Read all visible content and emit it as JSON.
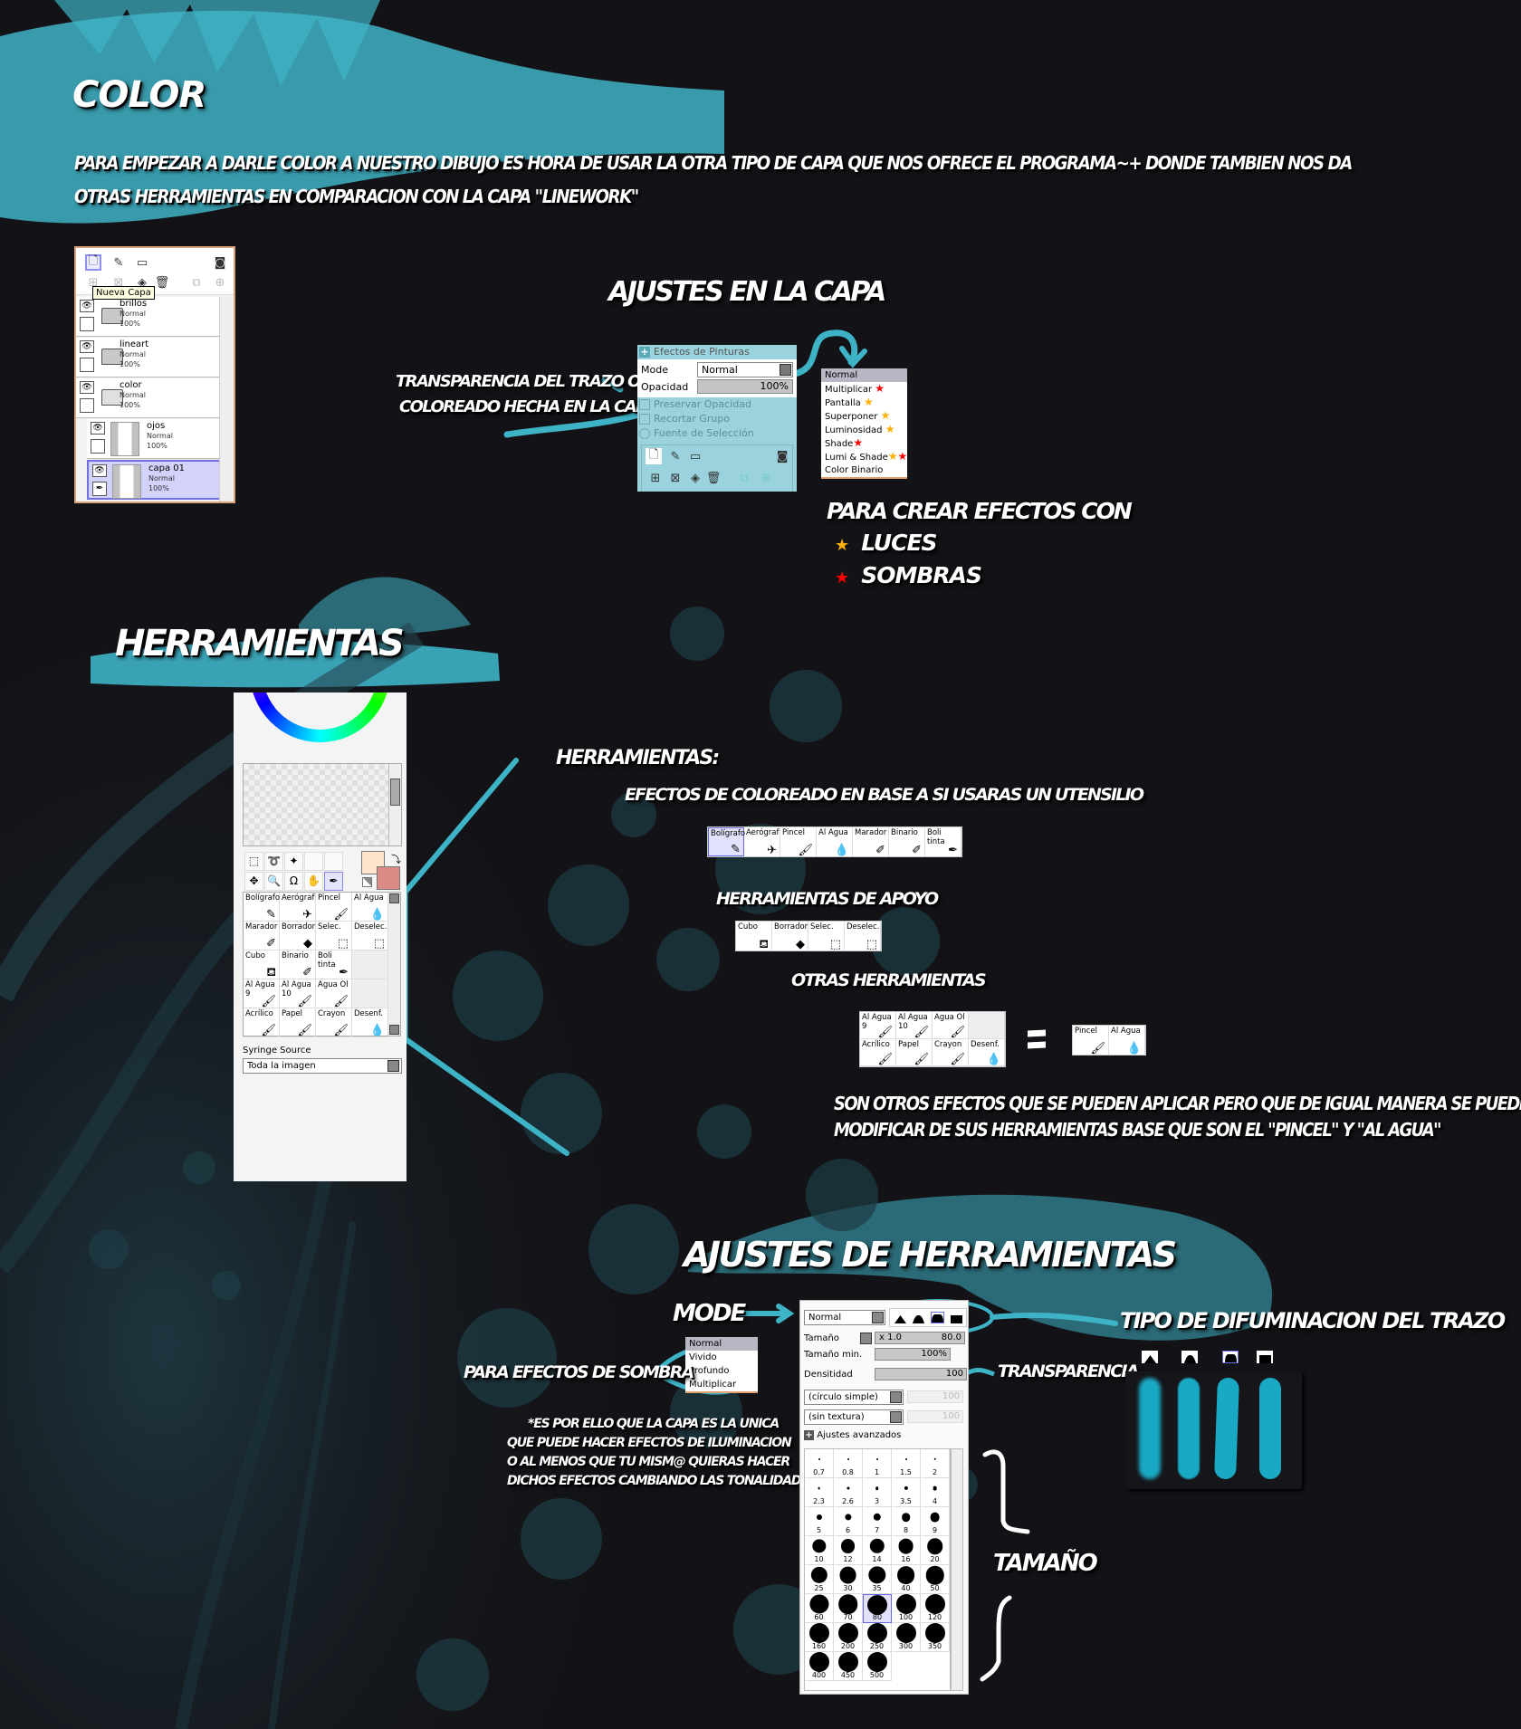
{
  "colors": {
    "background": "#131317",
    "accent": "#3fb3c6",
    "light_star": "#ffb000",
    "shadow_star": "#ff0000"
  },
  "color_section": {
    "title": "Color",
    "intro_line1": "Para empezar a darle color a nuestro dibujo es hora de usar la otra tipo de capa que nos ofrece el programa~+ donde tambien nos da",
    "intro_line2": "otras herramientas en comparacion con la capa \"linework\""
  },
  "layers_panel": {
    "tooltip": "Nueva Capa",
    "layers": [
      {
        "name": "brillos",
        "mode": "Normal",
        "opacity": "100%",
        "type": "folder"
      },
      {
        "name": "lineart",
        "mode": "Normal",
        "opacity": "100%",
        "type": "folder"
      },
      {
        "name": "color",
        "mode": "Normal",
        "opacity": "100%",
        "type": "folder-open"
      },
      {
        "name": "ojos",
        "mode": "Normal",
        "opacity": "100%",
        "type": "layer"
      },
      {
        "name": "capa 01",
        "mode": "Normal",
        "opacity": "100%",
        "type": "layer",
        "selected": true
      }
    ]
  },
  "layer_settings": {
    "title": "Ajustes en la capa",
    "panel_title": "Efectos de Pinturas",
    "mode_label": "Mode",
    "mode_value": "Normal",
    "opacity_label": "Opacidad",
    "opacity_value": "100%",
    "options": [
      "Preservar Opacidad",
      "Recortar Grupo",
      "Fuente de Selección"
    ],
    "annotation_opacity_line1": "Transparencia  del trazo o",
    "annotation_opacity_line2": "coloreado hecha en la capa",
    "mode_options": [
      {
        "label": "Normal",
        "stars": []
      },
      {
        "label": "Multiplicar",
        "stars": [
          "shadow"
        ]
      },
      {
        "label": "Pantalla",
        "stars": [
          "light"
        ]
      },
      {
        "label": "Superponer",
        "stars": [
          "light"
        ]
      },
      {
        "label": "Luminosidad",
        "stars": [
          "light"
        ]
      },
      {
        "label": "Shade",
        "stars": [
          "shadow"
        ]
      },
      {
        "label": "Lumi & Shade",
        "stars": [
          "light",
          "shadow"
        ]
      },
      {
        "label": "Color Binario",
        "stars": []
      }
    ],
    "effects_title": "Para crear efectos con",
    "legend_light": "Luces",
    "legend_shadow": "Sombras",
    "star_glyph": "★"
  },
  "tools_section": {
    "title": "Herramientas",
    "panel": {
      "tool_grid": [
        {
          "label": "Bolígrafo",
          "icon": "pencil-icon"
        },
        {
          "label": "Aerógraf",
          "icon": "airbrush-icon"
        },
        {
          "label": "Pincel",
          "icon": "brush-icon"
        },
        {
          "label": "Al Agua",
          "icon": "water-brush-icon"
        },
        {
          "label": "Marador",
          "icon": "marker-icon"
        },
        {
          "label": "Borrador",
          "icon": "eraser-icon"
        },
        {
          "label": "Selec.",
          "icon": "select-pen-icon"
        },
        {
          "label": "Deselec.",
          "icon": "deselect-eraser-icon"
        },
        {
          "label": "Cubo",
          "icon": "bucket-icon"
        },
        {
          "label": "Binario",
          "icon": "binary-pen-icon"
        },
        {
          "label": "Boli tinta",
          "icon": "ink-pen-icon"
        },
        {
          "label": "",
          "icon": ""
        },
        {
          "label": "Al Agua 9",
          "icon": "brush-icon"
        },
        {
          "label": "Al Agua 10",
          "icon": "brush-icon"
        },
        {
          "label": "Agua Ol",
          "icon": "brush-icon"
        },
        {
          "label": "",
          "icon": ""
        },
        {
          "label": "Acrílico",
          "icon": "brush-icon"
        },
        {
          "label": "Papel",
          "icon": "brush-icon"
        },
        {
          "label": "Crayon",
          "icon": "brush-icon"
        },
        {
          "label": "Desenf.",
          "icon": "blur-icon"
        }
      ],
      "syringe_label": "Syringe Source",
      "syringe_value": "Toda la imagen",
      "foreground_color": "#ffe3cc",
      "background_color": "#dc8a86"
    },
    "heading": "Herramientas:",
    "coloring_label": "Efectos de coloreado en base a si usaras un utensilio",
    "coloring_tools": [
      "Bolígrafo",
      "Aerógraf",
      "Pincel",
      "Al Agua",
      "Marador",
      "Binario",
      "Boli tinta"
    ],
    "support_label": "Herramientas de apoyo",
    "support_tools": [
      "Cubo",
      "Borrador",
      "Selec.",
      "Deselec."
    ],
    "other_label": "Otras herramientas",
    "other_tools": [
      "Al Agua 9",
      "Al Agua 10",
      "Agua Ol",
      "",
      "Acrílico",
      "Papel",
      "Crayon",
      "Desenf."
    ],
    "equals": "=",
    "base_tools": [
      "Pincel",
      "Al Agua"
    ],
    "explanation_line1": "Son otros efectos que se pueden aplicar pero que de igual manera se pueden",
    "explanation_line2": "modificar de sus herramientas base que son el \"Pincel\" y \"Al Agua\""
  },
  "tool_settings": {
    "title": "Ajustes de herramientas",
    "mode_label": "Mode",
    "mode_value": "Normal",
    "mode_options": [
      "Normal",
      "Vivido",
      "Profundo",
      "Multiplicar"
    ],
    "shadow_note": "Para efectos de sombra",
    "note_lines": [
      "*Es por ello que la capa es la unica",
      "que puede hacer efectos de iluminacion",
      "o al menos que tu mism@ quieras hacer",
      "dichos efectos cambiando las tonalidades"
    ],
    "size_label": "Tamaño",
    "size_multiplier": "x 1.0",
    "size_value": "80.0",
    "min_size_label": "Tamaño min.",
    "min_size_value": "100%",
    "density_label": "Densitidad",
    "density_value": "100",
    "shape_value": "(círculo simple)",
    "shape_strength": "100",
    "texture_value": "(sin textura)",
    "texture_strength": "100",
    "advanced_label": "Ajustes avanzados",
    "brush_sizes": [
      "0.7",
      "0.8",
      "1",
      "1.5",
      "2",
      "2.3",
      "2.6",
      "3",
      "3.5",
      "4",
      "5",
      "6",
      "7",
      "8",
      "9",
      "10",
      "12",
      "14",
      "16",
      "20",
      "25",
      "30",
      "35",
      "40",
      "50",
      "60",
      "70",
      "80",
      "100",
      "120",
      "160",
      "200",
      "250",
      "300",
      "350",
      "400",
      "450",
      "500"
    ],
    "selected_size": "80",
    "blur_type_label": "Tipo de difuminacion del trazo",
    "blur_types": [
      "soft-edge",
      "medium-edge",
      "hard-edge",
      "flat-edge"
    ],
    "selected_blur_type": "hard-edge",
    "transparency_label": "Transparencia",
    "size_annotation": "Tamaño"
  }
}
